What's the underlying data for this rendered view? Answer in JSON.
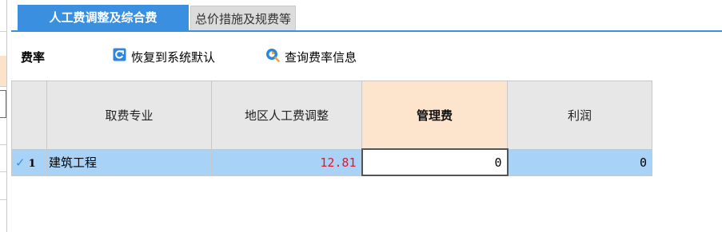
{
  "tabs": [
    {
      "label": "人工费调整及综合费",
      "active": true
    },
    {
      "label": "总价措施及规费等",
      "active": false
    }
  ],
  "toolbar": {
    "title": "费率",
    "restore_label": "恢复到系统默认",
    "query_label": "查询费率信息"
  },
  "table": {
    "columns": [
      "",
      "取费专业",
      "地区人工费调整",
      "管理费",
      "利润"
    ],
    "highlighted_column": "管理费",
    "rows": [
      {
        "checked": true,
        "row_number": "1",
        "name": "建筑工程",
        "labor_adjust": "12.81",
        "mgmt_fee": "0",
        "profit": "0"
      }
    ]
  },
  "colors": {
    "accent": "#3b8fe0",
    "row_selected": "#a9d3f6",
    "header_highlight": "#fde4cc",
    "value_red": "#e0182c"
  }
}
